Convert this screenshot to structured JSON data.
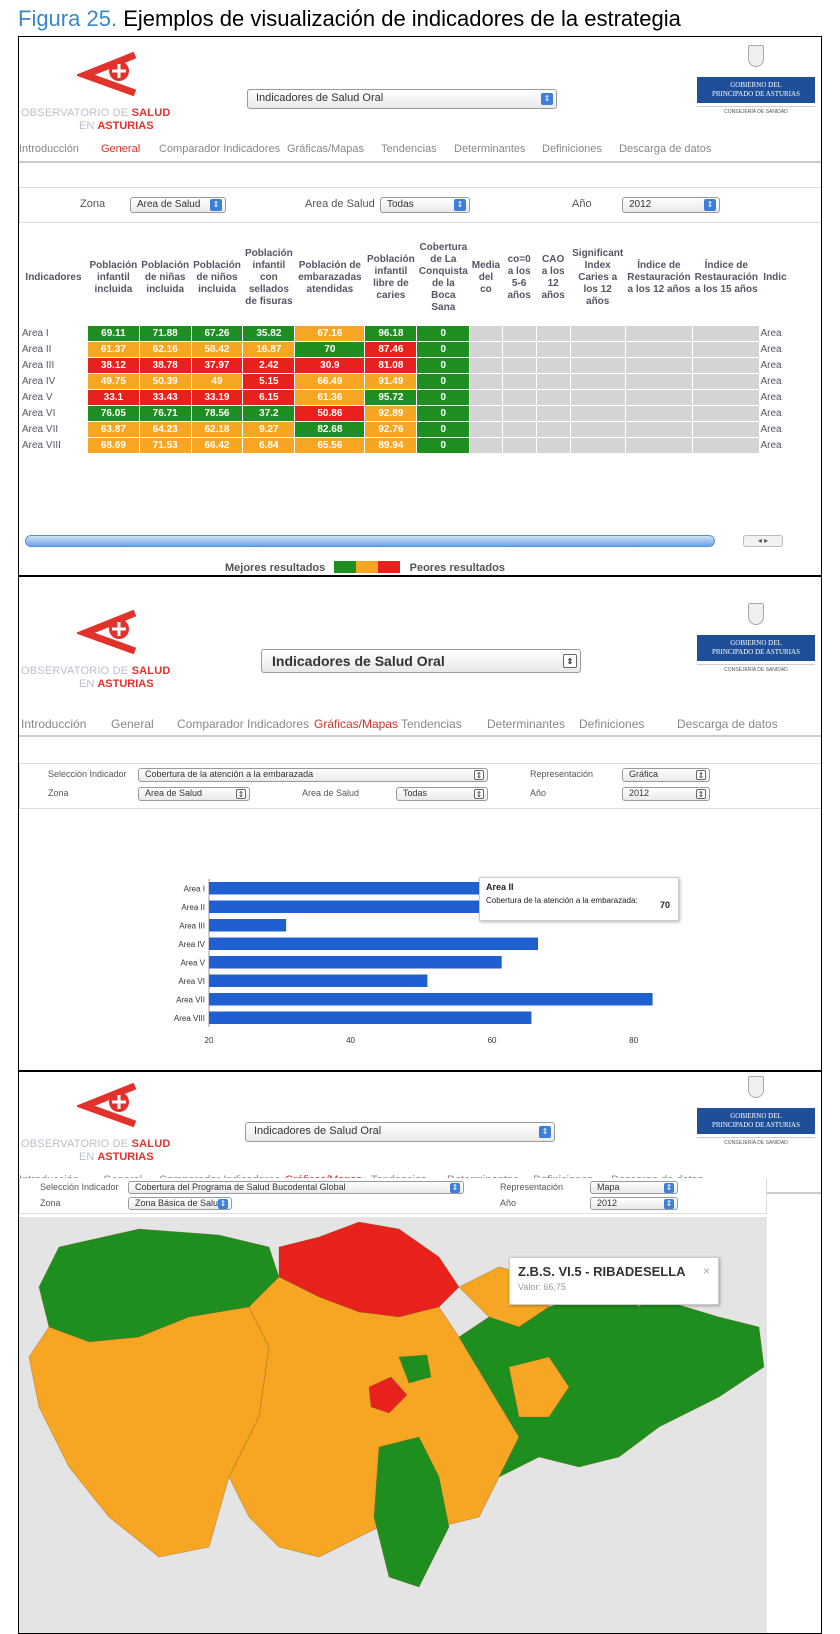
{
  "caption": {
    "figure_label": "Figura 25.",
    "text": "Ejemplos de visualización de indicadores de la estrategia"
  },
  "branding": {
    "obs_line1_prefix": "OBSERVATORIO DE ",
    "obs_line1_accent": "SALUD",
    "obs_line2_prefix": "EN ",
    "obs_line2_accent": "ASTURIAS",
    "gov_line1": "GOBIERNO DEL",
    "gov_line2": "PRINCIPADO DE ASTURIAS",
    "gov_line3": "CONSEJERÍA DE SANIDAD"
  },
  "indicator_select": "Indicadores de Salud Oral",
  "nav": [
    "Introducción",
    "General",
    "Comparador Indicadores",
    "Gráficas/Mapas",
    "Tendencias",
    "Determinantes",
    "Definiciones",
    "Descarga de datos"
  ],
  "panel1": {
    "filters": {
      "zona_label": "Zona",
      "zona_value": "Area de Salud",
      "area_label": "Area de Salud",
      "area_value": "Todas",
      "anio_label": "Año",
      "anio_value": "2012"
    },
    "headers": [
      "Indicadores",
      "Población infantil incluida",
      "Población de niñas incluida",
      "Población de niños incluida",
      "Población infantil con sellados de fisuras",
      "Población de embarazadas atendidas",
      "Población infantil libre de caries",
      "Cobertura de La Conquista de la Boca Sana",
      "Media del co",
      "co=0 a los 5-6 años",
      "CAO a los 12 años",
      "Significant Index Caries a los 12 años",
      "Índice de Restauración a los 12 años",
      "Índice de Restauración a los 15 años",
      "Indic"
    ],
    "rows": [
      {
        "label": "Area I",
        "values": [
          "69.11",
          "71.88",
          "67.26",
          "35.82",
          "67.16",
          "96.18",
          "0"
        ],
        "colors": [
          "g",
          "g",
          "g",
          "g",
          "o",
          "g",
          "g"
        ],
        "extra": "Area"
      },
      {
        "label": "Area II",
        "values": [
          "61.37",
          "62.16",
          "58.42",
          "16.87",
          "70",
          "87.46",
          "0"
        ],
        "colors": [
          "o",
          "o",
          "o",
          "o",
          "g",
          "r",
          "g"
        ],
        "extra": "Area"
      },
      {
        "label": "Area III",
        "values": [
          "38.12",
          "38.78",
          "37.97",
          "2.42",
          "30.9",
          "81.08",
          "0"
        ],
        "colors": [
          "r",
          "r",
          "r",
          "r",
          "r",
          "r",
          "g"
        ],
        "extra": "Area"
      },
      {
        "label": "Area IV",
        "values": [
          "49.75",
          "50.39",
          "49",
          "5.15",
          "66.49",
          "91.49",
          "0"
        ],
        "colors": [
          "o",
          "o",
          "o",
          "r",
          "o",
          "o",
          "g"
        ],
        "extra": "Area"
      },
      {
        "label": "Area V",
        "values": [
          "33.1",
          "33.43",
          "33.19",
          "6.15",
          "61.36",
          "95.72",
          "0"
        ],
        "colors": [
          "r",
          "r",
          "r",
          "r",
          "o",
          "g",
          "g"
        ],
        "extra": "Area"
      },
      {
        "label": "Area VI",
        "values": [
          "76.05",
          "76.71",
          "78.56",
          "37.2",
          "50.86",
          "92.89",
          "0"
        ],
        "colors": [
          "g",
          "g",
          "g",
          "g",
          "r",
          "o",
          "g"
        ],
        "extra": "Area"
      },
      {
        "label": "Area VII",
        "values": [
          "63.87",
          "64.23",
          "62.18",
          "9.27",
          "82.68",
          "92.76",
          "0"
        ],
        "colors": [
          "o",
          "o",
          "o",
          "o",
          "g",
          "o",
          "g"
        ],
        "extra": "Area"
      },
      {
        "label": "Area VIII",
        "values": [
          "68.69",
          "71.53",
          "66.42",
          "6.84",
          "65.56",
          "89.94",
          "0"
        ],
        "colors": [
          "o",
          "o",
          "o",
          "o",
          "o",
          "o",
          "g"
        ],
        "extra": "Area"
      }
    ],
    "legend": {
      "better": "Mejores resultados",
      "worse": "Peores resultados"
    },
    "scroll_buttons": "◂ ▸"
  },
  "panel2": {
    "filters": {
      "sel_label": "Selección Indicador",
      "sel_value": "Cobertura de la atención a la embarazada",
      "rep_label": "Representación",
      "rep_value": "Gráfica",
      "zona_label": "Zona",
      "zona_value": "Area de Salud",
      "area_label": "Area de Salud",
      "area_value": "Todas",
      "anio_label": "Año",
      "anio_value": "2012"
    },
    "tooltip": {
      "title": "Area II",
      "label": "Cobertura de la atención a la embarazada:",
      "value": "70"
    }
  },
  "chart_data": {
    "type": "bar",
    "orientation": "horizontal",
    "categories": [
      "Area I",
      "Area II",
      "Area III",
      "Area IV",
      "Area V",
      "Area VI",
      "Area VII",
      "Area VIII"
    ],
    "values": [
      67.16,
      70,
      30.9,
      66.49,
      61.36,
      50.86,
      82.68,
      65.56
    ],
    "xlim": [
      20,
      85
    ],
    "xticks": [
      20,
      40,
      60,
      80
    ],
    "color": "#1f5fd0"
  },
  "panel3": {
    "filters": {
      "sel_label": "Selección Indicador",
      "sel_value": "Cobertura del Programa de Salud Bucodental Global",
      "rep_label": "Representación",
      "rep_value": "Mapa",
      "zona_label": "Zona",
      "zona_value": "Zona Básica de Saluc",
      "anio_label": "Año",
      "anio_value": "2012"
    },
    "tooltip": {
      "title": "Z.B.S. VI.5 - RIBADESELLA",
      "value": "Valor: 66,75",
      "close": "×"
    }
  },
  "colors": {
    "better": "#1e8e1e",
    "mid": "#f7a623",
    "worse": "#e8211d",
    "nav_active": "#d4322c",
    "brand_red": "#e2322b",
    "gov_blue": "#1f4f99"
  }
}
